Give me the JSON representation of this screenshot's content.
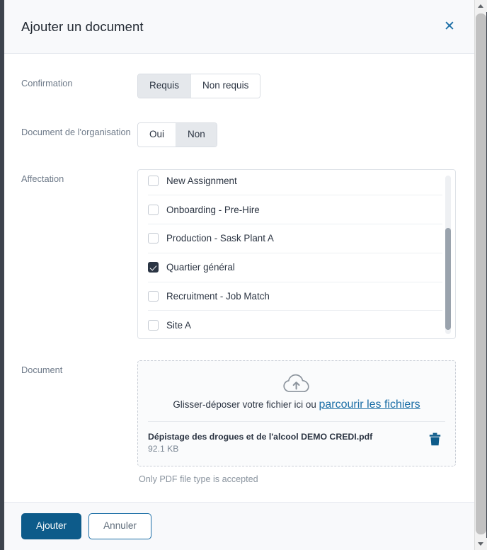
{
  "dialog": {
    "title": "Ajouter un document",
    "close_icon": "close-icon"
  },
  "fields": {
    "confirmation": {
      "label": "Confirmation",
      "options": [
        "Requis",
        "Non requis"
      ],
      "selected": "Requis"
    },
    "organisation_document": {
      "label": "Document de l'organisation",
      "options": [
        "Oui",
        "Non"
      ],
      "selected": "Non"
    },
    "affectation": {
      "label": "Affectation",
      "items": [
        {
          "label": "New Assignment",
          "checked": false
        },
        {
          "label": "Onboarding - Pre-Hire",
          "checked": false
        },
        {
          "label": "Production - Sask Plant A",
          "checked": false
        },
        {
          "label": "Quartier général",
          "checked": true
        },
        {
          "label": "Recruitment - Job Match",
          "checked": false
        },
        {
          "label": "Site A",
          "checked": false
        }
      ]
    },
    "document": {
      "label": "Document",
      "upload_icon": "cloud-upload-icon",
      "drop_text": "Glisser-déposer votre fichier ici ou ",
      "browse_link": "parcourir les fichiers",
      "file_name": "Dépistage des drogues et de l'alcool DEMO CREDI.pdf",
      "file_size": "92.1 KB",
      "delete_icon": "trash-icon",
      "hint": "Only PDF file type is accepted"
    }
  },
  "footer": {
    "submit_label": "Ajouter",
    "cancel_label": "Annuler"
  },
  "colors": {
    "accent_blue": "#0d5b8a",
    "link_blue": "#1b6ea6",
    "checkbox_checked": "#2b3544",
    "label_gray": "#6e7a89",
    "header_bg": "#f8f9fb"
  }
}
